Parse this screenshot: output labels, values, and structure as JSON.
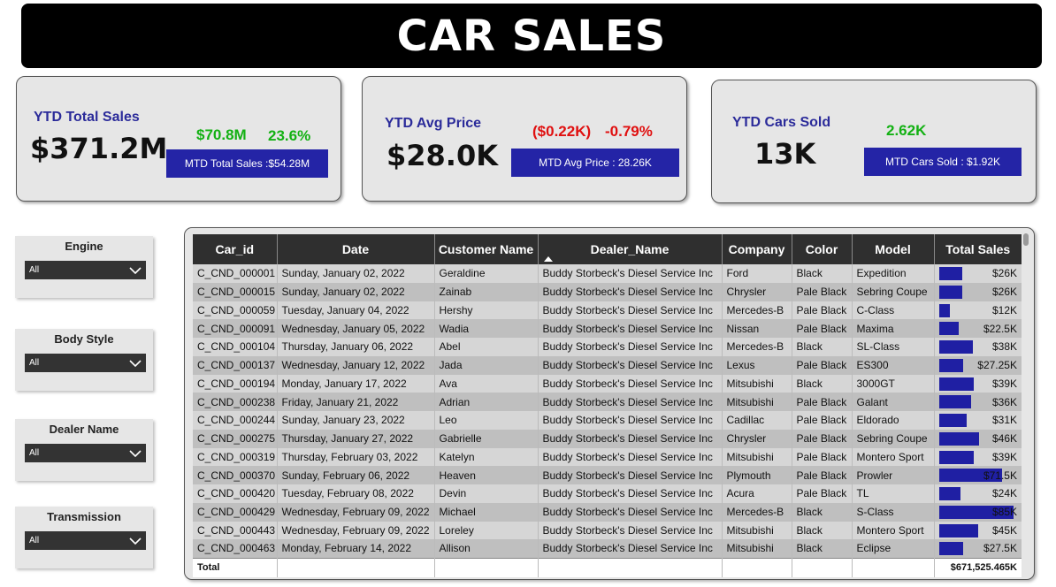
{
  "title": "CAR SALES",
  "kpis": {
    "total_sales": {
      "label": "YTD Total Sales",
      "value": "$371.2M",
      "delta_amount": "$70.8M",
      "delta_pct": "23.6%",
      "mtd": "MTD Total Sales :$54.28M"
    },
    "avg_price": {
      "label": "YTD Avg Price",
      "value": "$28.0K",
      "delta_amount": "($0.22K)",
      "delta_pct": "-0.79%",
      "mtd": "MTD Avg Price : 28.26K"
    },
    "cars_sold": {
      "label": "YTD Cars Sold",
      "value": "13K",
      "delta_amount": "2.62K",
      "mtd": "MTD Cars Sold : $1.92K"
    }
  },
  "colors": {
    "kpi_label": "#2b2b9a",
    "positive": "#13b113",
    "negative": "#e01010",
    "accent_bar": "#1f1fa3"
  },
  "slicers": [
    {
      "label": "Engine",
      "selected": "All"
    },
    {
      "label": "Body Style",
      "selected": "All"
    },
    {
      "label": "Dealer Name",
      "selected": "All"
    },
    {
      "label": "Transmission",
      "selected": "All"
    }
  ],
  "table": {
    "columns": [
      "Car_id",
      "Date",
      "Customer Name",
      "Dealer_Name",
      "Company",
      "Color",
      "Model",
      "Total Sales"
    ],
    "sorted_column": "Dealer_Name",
    "rows": [
      {
        "car_id": "C_CND_000001",
        "date": "Sunday, January 02, 2022",
        "customer": "Geraldine",
        "dealer": "Buddy Storbeck's Diesel Service Inc",
        "company": "Ford",
        "color": "Black",
        "model": "Expedition",
        "sales": "$26K",
        "sales_value": 26000
      },
      {
        "car_id": "C_CND_000015",
        "date": "Sunday, January 02, 2022",
        "customer": "Zainab",
        "dealer": "Buddy Storbeck's Diesel Service Inc",
        "company": "Chrysler",
        "color": "Pale Black",
        "model": "Sebring Coupe",
        "sales": "$26K",
        "sales_value": 26000
      },
      {
        "car_id": "C_CND_000059",
        "date": "Tuesday, January 04, 2022",
        "customer": "Hershy",
        "dealer": "Buddy Storbeck's Diesel Service Inc",
        "company": "Mercedes-B",
        "color": "Pale Black",
        "model": "C-Class",
        "sales": "$12K",
        "sales_value": 12000
      },
      {
        "car_id": "C_CND_000091",
        "date": "Wednesday, January 05, 2022",
        "customer": "Wadia",
        "dealer": "Buddy Storbeck's Diesel Service Inc",
        "company": "Nissan",
        "color": "Pale Black",
        "model": "Maxima",
        "sales": "$22.5K",
        "sales_value": 22500
      },
      {
        "car_id": "C_CND_000104",
        "date": "Thursday, January 06, 2022",
        "customer": "Abel",
        "dealer": "Buddy Storbeck's Diesel Service Inc",
        "company": "Mercedes-B",
        "color": "Black",
        "model": "SL-Class",
        "sales": "$38K",
        "sales_value": 38000
      },
      {
        "car_id": "C_CND_000137",
        "date": "Wednesday, January 12, 2022",
        "customer": "Jada",
        "dealer": "Buddy Storbeck's Diesel Service Inc",
        "company": "Lexus",
        "color": "Pale Black",
        "model": "ES300",
        "sales": "$27.25K",
        "sales_value": 27250
      },
      {
        "car_id": "C_CND_000194",
        "date": "Monday, January 17, 2022",
        "customer": "Ava",
        "dealer": "Buddy Storbeck's Diesel Service Inc",
        "company": "Mitsubishi",
        "color": "Black",
        "model": "3000GT",
        "sales": "$39K",
        "sales_value": 39000
      },
      {
        "car_id": "C_CND_000238",
        "date": "Friday, January 21, 2022",
        "customer": "Adrian",
        "dealer": "Buddy Storbeck's Diesel Service Inc",
        "company": "Mitsubishi",
        "color": "Pale Black",
        "model": "Galant",
        "sales": "$36K",
        "sales_value": 36000
      },
      {
        "car_id": "C_CND_000244",
        "date": "Sunday, January 23, 2022",
        "customer": "Leo",
        "dealer": "Buddy Storbeck's Diesel Service Inc",
        "company": "Cadillac",
        "color": "Pale Black",
        "model": "Eldorado",
        "sales": "$31K",
        "sales_value": 31000
      },
      {
        "car_id": "C_CND_000275",
        "date": "Thursday, January 27, 2022",
        "customer": "Gabrielle",
        "dealer": "Buddy Storbeck's Diesel Service Inc",
        "company": "Chrysler",
        "color": "Pale Black",
        "model": "Sebring Coupe",
        "sales": "$46K",
        "sales_value": 46000
      },
      {
        "car_id": "C_CND_000319",
        "date": "Thursday, February 03, 2022",
        "customer": "Katelyn",
        "dealer": "Buddy Storbeck's Diesel Service Inc",
        "company": "Mitsubishi",
        "color": "Pale Black",
        "model": "Montero Sport",
        "sales": "$39K",
        "sales_value": 39000
      },
      {
        "car_id": "C_CND_000370",
        "date": "Sunday, February 06, 2022",
        "customer": "Heaven",
        "dealer": "Buddy Storbeck's Diesel Service Inc",
        "company": "Plymouth",
        "color": "Pale Black",
        "model": "Prowler",
        "sales": "$71.5K",
        "sales_value": 71500
      },
      {
        "car_id": "C_CND_000420",
        "date": "Tuesday, February 08, 2022",
        "customer": "Devin",
        "dealer": "Buddy Storbeck's Diesel Service Inc",
        "company": "Acura",
        "color": "Pale Black",
        "model": "TL",
        "sales": "$24K",
        "sales_value": 24000
      },
      {
        "car_id": "C_CND_000429",
        "date": "Wednesday, February 09, 2022",
        "customer": "Michael",
        "dealer": "Buddy Storbeck's Diesel Service Inc",
        "company": "Mercedes-B",
        "color": "Black",
        "model": "S-Class",
        "sales": "$85K",
        "sales_value": 85000
      },
      {
        "car_id": "C_CND_000443",
        "date": "Wednesday, February 09, 2022",
        "customer": "Loreley",
        "dealer": "Buddy Storbeck's Diesel Service Inc",
        "company": "Mitsubishi",
        "color": "Black",
        "model": "Montero Sport",
        "sales": "$45K",
        "sales_value": 45000
      },
      {
        "car_id": "C_CND_000463",
        "date": "Monday, February 14, 2022",
        "customer": "Allison",
        "dealer": "Buddy Storbeck's Diesel Service Inc",
        "company": "Mitsubishi",
        "color": "Black",
        "model": "Eclipse",
        "sales": "$27.5K",
        "sales_value": 27500
      }
    ],
    "sales_max": 85000,
    "total_label": "Total",
    "total_value": "$671,525.465K"
  }
}
